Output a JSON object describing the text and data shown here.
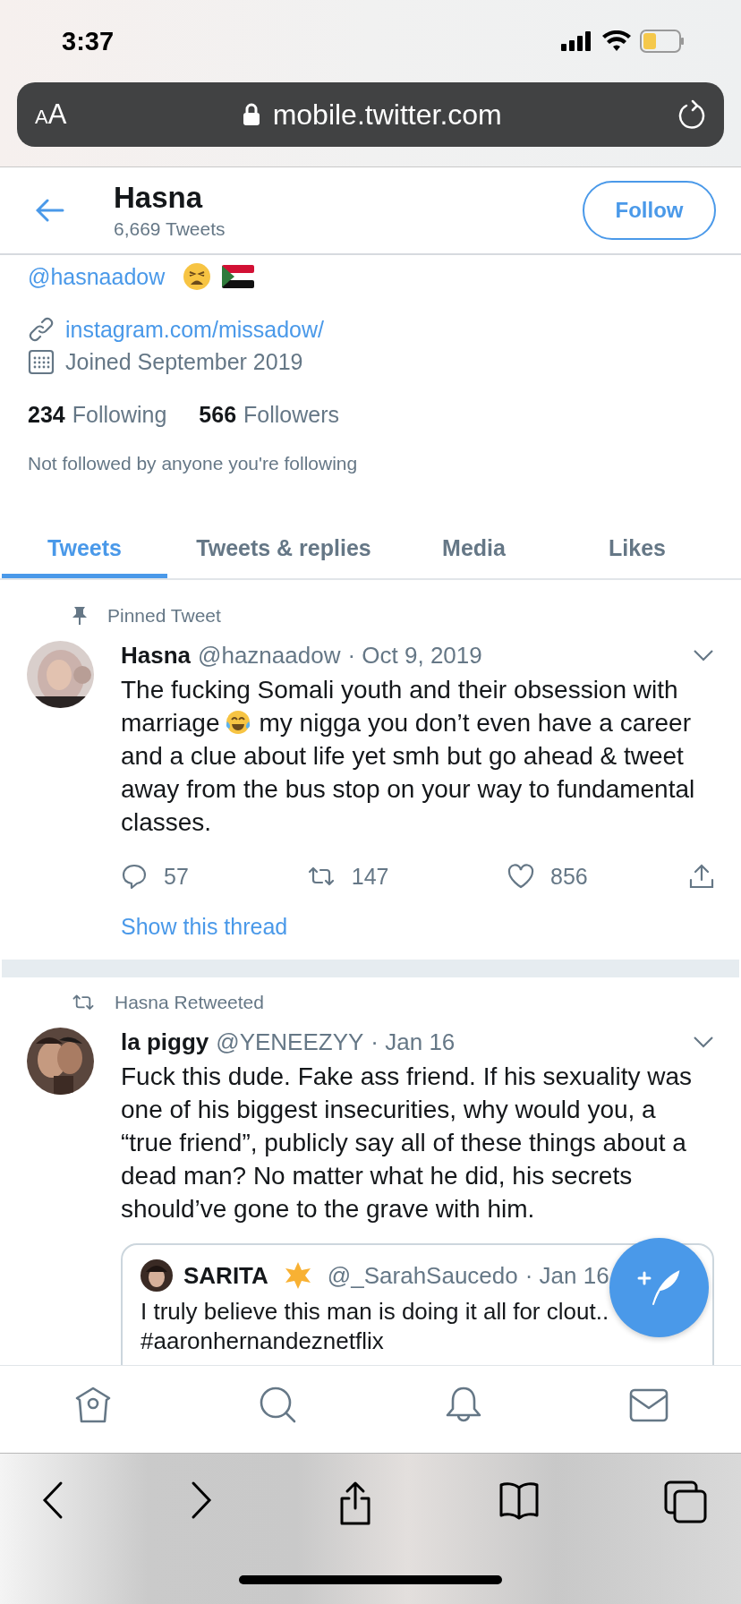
{
  "status_bar": {
    "time": "3:37"
  },
  "browser": {
    "text_size": "AA",
    "url": "mobile.twitter.com"
  },
  "header": {
    "name": "Hasna",
    "tweet_count": "6,669 Tweets",
    "follow": "Follow"
  },
  "profile": {
    "handle": "@hasnaadow",
    "link": "instagram.com/missadow/",
    "joined": "Joined September 2019",
    "following_count": "234",
    "following_label": "Following",
    "followers_count": "566",
    "followers_label": "Followers",
    "followed_by": "Not followed by anyone you're following"
  },
  "tabs": [
    {
      "label": "Tweets",
      "selected": true
    },
    {
      "label": "Tweets & replies",
      "selected": false
    },
    {
      "label": "Media",
      "selected": false
    },
    {
      "label": "Likes",
      "selected": false
    }
  ],
  "tweets": [
    {
      "kind": "pinned",
      "context": "Pinned Tweet",
      "name": "Hasna",
      "handle": "@haznaadow",
      "date": "· Oct 9, 2019",
      "text": [
        {
          "kind": "text",
          "value": "The fucking Somali youth and their obsession with marriage"
        },
        {
          "kind": "emoji"
        },
        {
          "kind": "text",
          "value": "my nigga you don’t even have a career and a clue about life yet smh but go ahead & tweet away from the bus stop on your way to fundamental classes."
        }
      ],
      "replies": "57",
      "retweets": "147",
      "likes": "856",
      "thread_link": "Show this thread"
    },
    {
      "kind": "retweet",
      "context": "Hasna Retweeted",
      "name": "la piggy",
      "handle": "@YENEEZYY",
      "date": "· Jan 16",
      "text": [
        {
          "kind": "text",
          "value": "Fuck this dude. Fake ass friend. If his sexuality was one of his biggest insecurities, why would you, a “true friend”, publicly say all of these things about a dead man? No matter what he did, his secrets should’ve gone to the grave with him."
        }
      ],
      "quote": {
        "name": "SARITA",
        "handle": "@_SarahSaucedo",
        "date": "· Jan 16",
        "text": "I truly believe this man is doing it all for clout..",
        "hashtag": "#aaronhernandeznetflix"
      }
    }
  ]
}
